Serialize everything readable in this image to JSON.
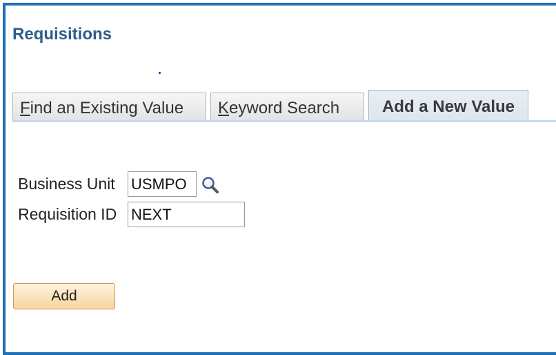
{
  "page": {
    "title": "Requisitions"
  },
  "tabs": [
    {
      "label_first": "F",
      "label_rest": "ind an Existing Value"
    },
    {
      "label_first": "K",
      "label_rest": "eyword Search"
    },
    {
      "label": "Add a New Value"
    }
  ],
  "form": {
    "business_unit": {
      "label": "Business Unit",
      "value": "USMPO"
    },
    "requisition_id": {
      "label": "Requisition ID",
      "value": "NEXT"
    }
  },
  "actions": {
    "add_label": "Add"
  },
  "colors": {
    "frame": "#1f6fb5",
    "title": "#2e5d8f",
    "button": "#f7d59f"
  }
}
